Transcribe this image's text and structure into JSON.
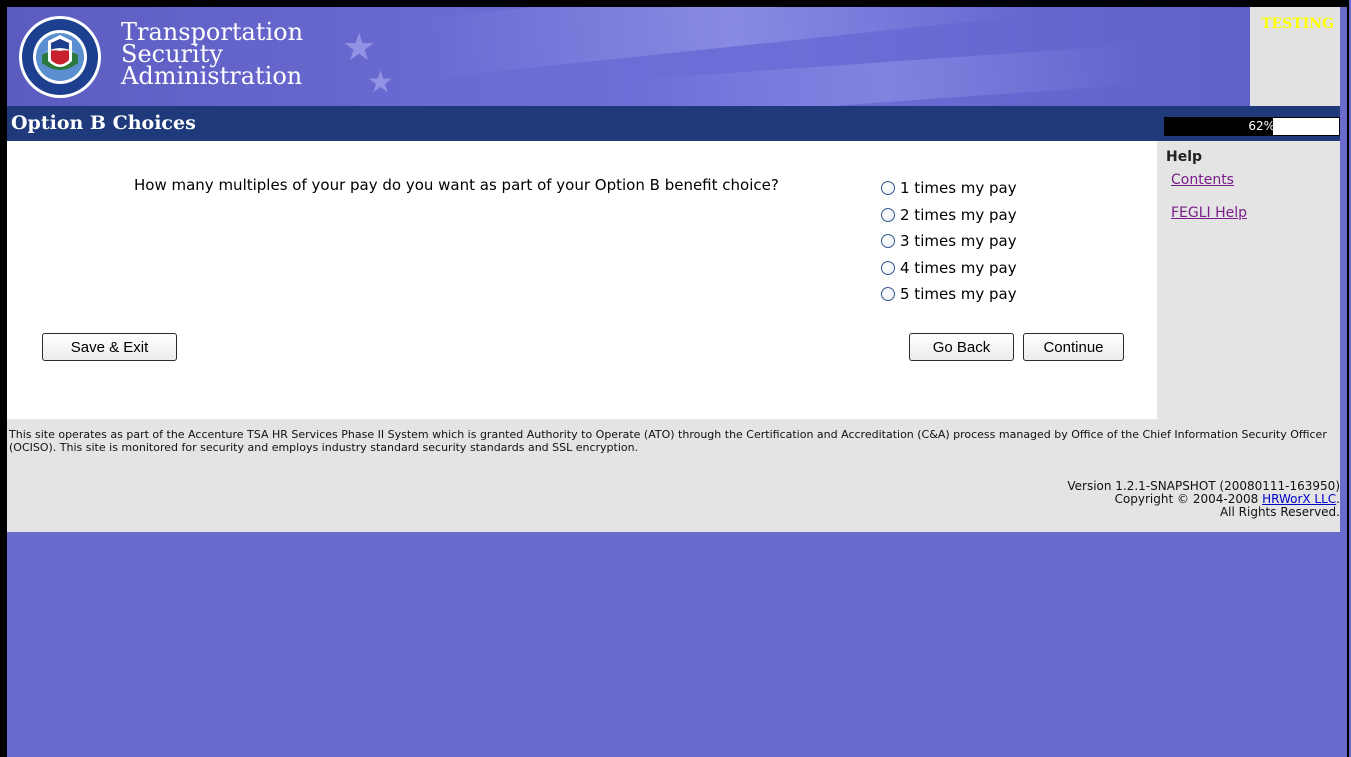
{
  "header": {
    "agency_line1": "Transportation",
    "agency_line2": "Security",
    "agency_line3": "Administration",
    "environment_badge": "TESTING"
  },
  "titlebar": {
    "title": "Option B Choices",
    "progress_fraction": 0.62,
    "progress_label": "62%"
  },
  "main": {
    "question": "How many multiples of your pay do you want as part of your Option B benefit choice?",
    "options": [
      "1 times my pay",
      "2 times my pay",
      "3 times my pay",
      "4 times my pay",
      "5 times my pay"
    ],
    "save_exit_label": "Save & Exit",
    "go_back_label": "Go Back",
    "continue_label": "Continue"
  },
  "sidebar": {
    "title": "Help",
    "contents_link": "Contents",
    "fegli_link": "FEGLI Help"
  },
  "footer": {
    "notice": "This site operates as part of the Accenture TSA HR Services Phase II System which is granted Authority to Operate (ATO) through the Certification and Accreditation (C&A) process managed by Office of the Chief Information Security Officer (OCISO). This site is monitored for security and employs industry standard security standards and SSL encryption.",
    "version": "Version 1.2.1-SNAPSHOT (20080111-163950)",
    "copyright_prefix": "Copyright © 2004-2008 ",
    "copyright_link": "HRWorX LLC",
    "copyright_suffix": ".",
    "rights": "All Rights Reserved."
  },
  "colors": {
    "background": "#6b6bcd",
    "titlebar": "#1f3a7a",
    "badge": "#ffff00",
    "help_link": "#7a1c8a"
  }
}
